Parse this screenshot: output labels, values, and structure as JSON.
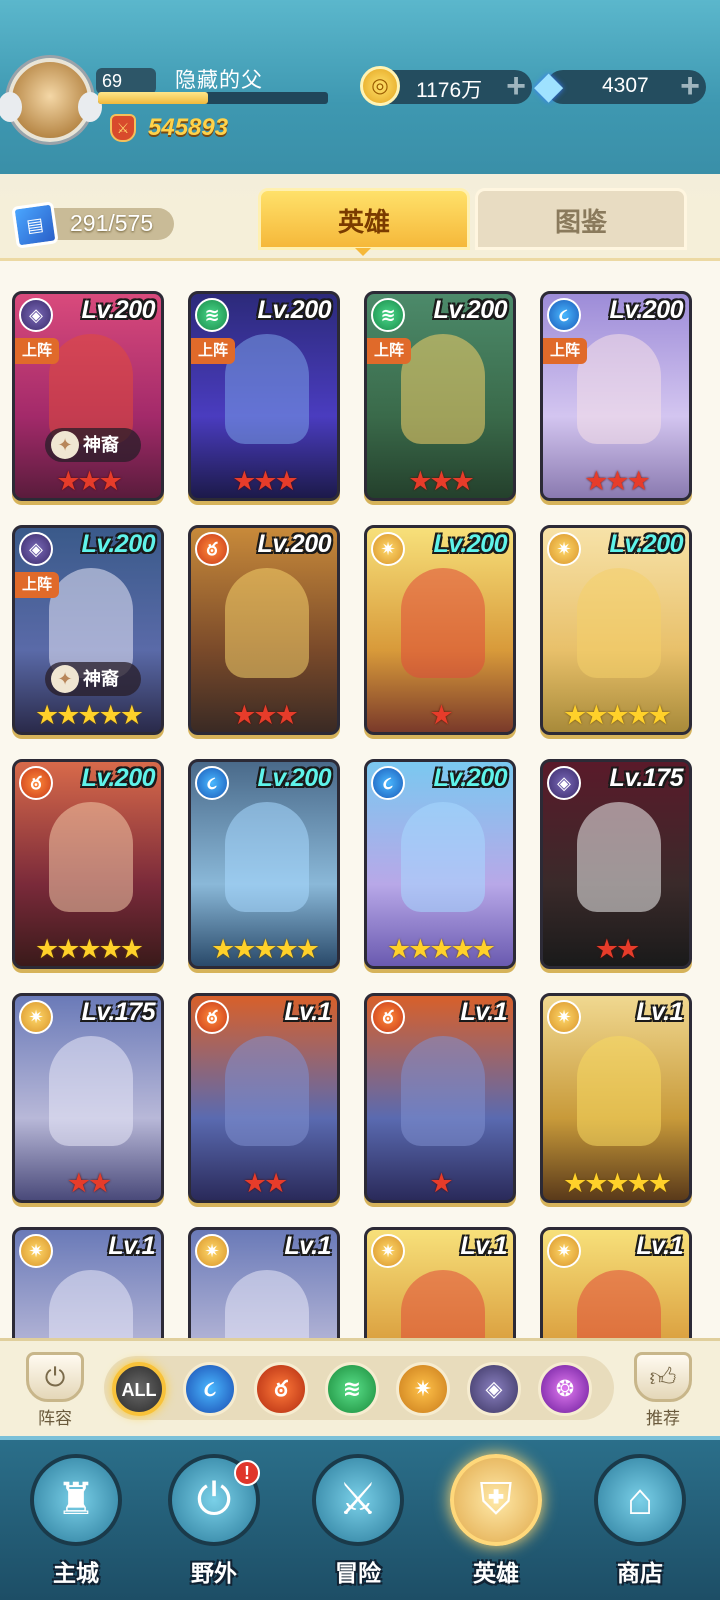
{
  "player": {
    "level": "69",
    "name": "隐藏的父",
    "exp_progress": 0.48,
    "power": "545893"
  },
  "resources": {
    "gold": "1176万",
    "gold_plus": "+",
    "diamonds": "4307",
    "diamonds_plus": "+"
  },
  "collection": {
    "count": "291/575"
  },
  "tabs": {
    "heroes": "英雄",
    "atlas": "图鉴"
  },
  "heroes": [
    {
      "level": "Lv.200",
      "element": "dark",
      "deploy": "上阵",
      "divine": "神裔",
      "stars": "★★★",
      "star_color": "red"
    },
    {
      "level": "Lv.200",
      "element": "wind",
      "deploy": "上阵",
      "stars": "★★★",
      "star_color": "red"
    },
    {
      "level": "Lv.200",
      "element": "wind",
      "deploy": "上阵",
      "stars": "★★★",
      "star_color": "red"
    },
    {
      "level": "Lv.200",
      "element": "water",
      "deploy": "上阵",
      "stars": "★★★",
      "star_color": "red"
    },
    {
      "level": "Lv.200",
      "element": "dark",
      "deploy": "上阵",
      "divine": "神裔",
      "stars": "★★★★★",
      "star_color": "gold"
    },
    {
      "level": "Lv.200",
      "element": "fire",
      "stars": "★★★",
      "star_color": "red"
    },
    {
      "level": "Lv.200",
      "element": "light",
      "stars": "★",
      "star_color": "red"
    },
    {
      "level": "Lv.200",
      "element": "light",
      "stars": "★★★★★",
      "star_color": "gold"
    },
    {
      "level": "Lv.200",
      "element": "fire",
      "stars": "★★★★★",
      "star_color": "gold"
    },
    {
      "level": "Lv.200",
      "element": "water",
      "stars": "★★★★★",
      "star_color": "gold"
    },
    {
      "level": "Lv.200",
      "element": "water",
      "stars": "★★★★★",
      "star_color": "gold"
    },
    {
      "level": "Lv.175",
      "element": "dark",
      "stars": "★★",
      "star_color": "red"
    },
    {
      "level": "Lv.175",
      "element": "light",
      "stars": "★★",
      "star_color": "red"
    },
    {
      "level": "Lv.1",
      "element": "fire",
      "stars": "★★",
      "star_color": "red"
    },
    {
      "level": "Lv.1",
      "element": "fire",
      "stars": "★",
      "star_color": "red"
    },
    {
      "level": "Lv.1",
      "element": "light",
      "stars": "★★★★★",
      "star_color": "gold"
    },
    {
      "level": "Lv.1",
      "element": "light"
    },
    {
      "level": "Lv.1",
      "element": "light"
    },
    {
      "level": "Lv.1",
      "element": "light"
    },
    {
      "level": "Lv.1",
      "element": "light"
    }
  ],
  "filters": {
    "lineup": "阵容",
    "recommend": "推荐",
    "all": "ALL",
    "items": [
      "all",
      "water",
      "fire",
      "wind",
      "light",
      "dark",
      "mystic"
    ]
  },
  "nav": {
    "city": "主城",
    "wild": "野外",
    "wild_alert": "!",
    "adventure": "冒险",
    "heroes": "英雄",
    "shop": "商店"
  }
}
